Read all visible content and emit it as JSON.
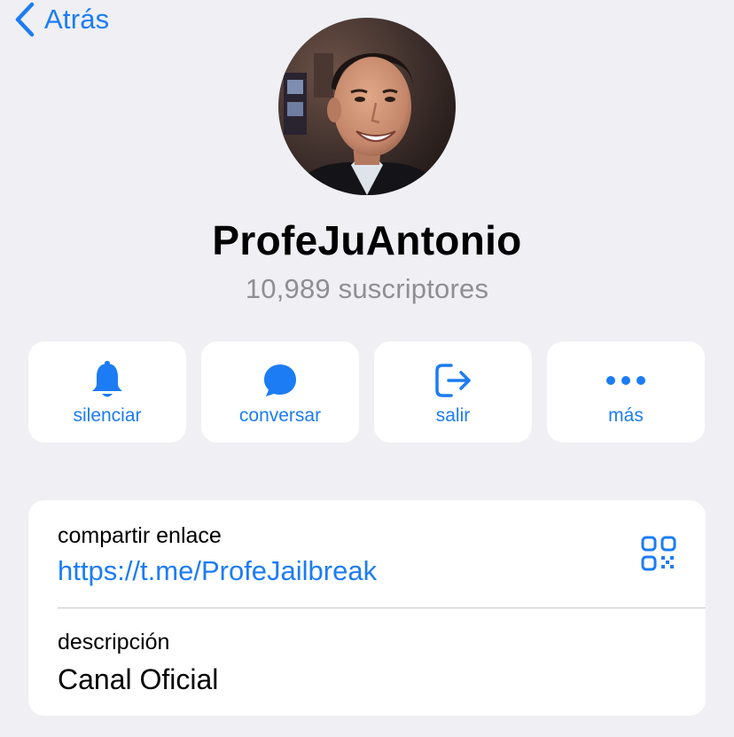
{
  "nav": {
    "back_label": "Atrás"
  },
  "profile": {
    "avatar_icon": "profile-photo",
    "name": "ProfeJuAntonio",
    "subscribers": "10,989 suscriptores"
  },
  "actions": [
    {
      "icon": "bell-icon",
      "label": "silenciar"
    },
    {
      "icon": "chat-bubble-icon",
      "label": "conversar"
    },
    {
      "icon": "leave-icon",
      "label": "salir"
    },
    {
      "icon": "more-icon",
      "label": "más"
    }
  ],
  "info": {
    "share_caption": "compartir enlace",
    "share_link": "https://t.me/ProfeJailbreak",
    "qr_icon": "qr-code-icon",
    "description_caption": "descripción",
    "description_value": "Canal Oficial"
  },
  "colors": {
    "accent": "#1c7cf4",
    "background": "#efeff4",
    "card": "#ffffff",
    "secondary_text": "#8e8e93"
  }
}
